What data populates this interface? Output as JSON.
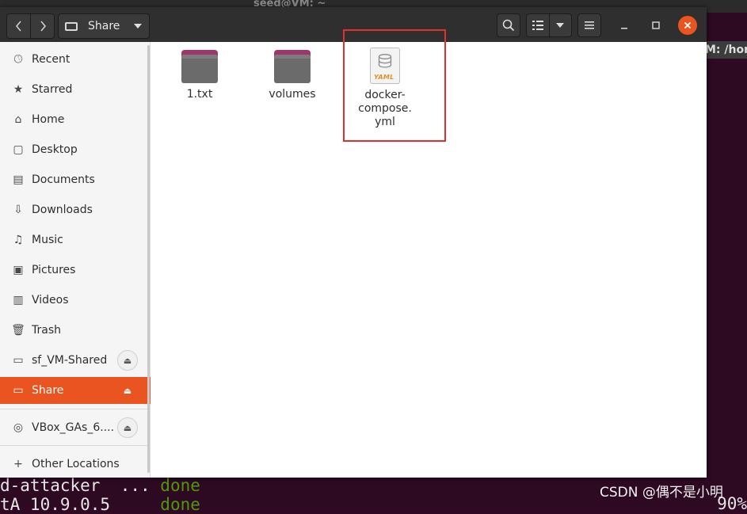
{
  "background": {
    "terminal_title": "seed@VM: ~",
    "terminal_tab": "M: /hom",
    "terminal_lines": [
      {
        "text": "d-attacker  ... ",
        "status": "done"
      },
      {
        "text": "tA 10.9.0.5     ",
        "status": "done"
      }
    ],
    "terminal_right_text": "90%",
    "watermark": "CSDN @偶不是小明"
  },
  "headerbar": {
    "back_icon": "chevron-left-icon",
    "forward_icon": "chevron-right-icon",
    "path_label": "Share"
  },
  "sidebar": {
    "items": [
      {
        "label": "Recent",
        "icon": "clock-icon"
      },
      {
        "label": "Starred",
        "icon": "star-icon"
      },
      {
        "label": "Home",
        "icon": "home-icon"
      },
      {
        "label": "Desktop",
        "icon": "desktop-icon"
      },
      {
        "label": "Documents",
        "icon": "document-icon"
      },
      {
        "label": "Downloads",
        "icon": "download-icon"
      },
      {
        "label": "Music",
        "icon": "music-icon"
      },
      {
        "label": "Pictures",
        "icon": "picture-icon"
      },
      {
        "label": "Videos",
        "icon": "video-icon"
      },
      {
        "label": "Trash",
        "icon": "trash-icon"
      },
      {
        "label": "sf_VM-Shared",
        "icon": "drive-icon"
      },
      {
        "label": "Share",
        "icon": "drive-icon"
      },
      {
        "label": "VBox_GAs_6....",
        "icon": "disc-icon"
      },
      {
        "label": "Other Locations",
        "icon": "plus-icon"
      }
    ]
  },
  "files": [
    {
      "name": "1.txt",
      "type": "folder"
    },
    {
      "name": "volumes",
      "type": "folder"
    },
    {
      "name_lines": [
        "docker-",
        "compose.",
        "yml"
      ],
      "type": "yaml",
      "icon_text": "YAML"
    }
  ],
  "colors": {
    "accent": "#e95420",
    "highlight_box": "#e03030"
  }
}
